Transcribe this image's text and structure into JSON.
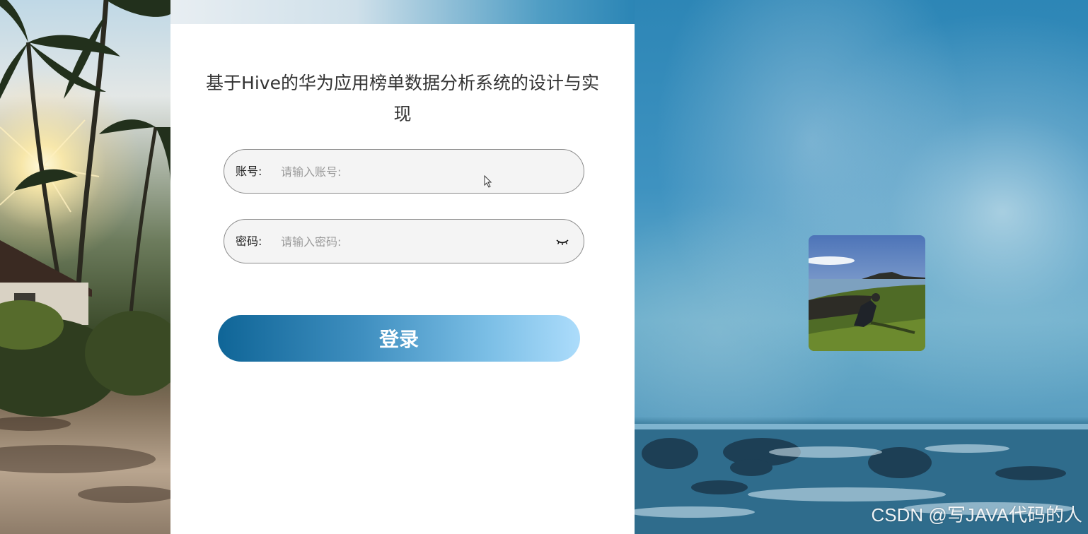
{
  "login": {
    "title": "基于Hive的华为应用榜单数据分析系统的设计与实现",
    "account_label": "账号:",
    "account_placeholder": "请输入账号:",
    "account_value": "",
    "password_label": "密码:",
    "password_placeholder": "请输入密码:",
    "password_value": "",
    "submit_label": "登录"
  },
  "watermark": "CSDN @写JAVA代码的人",
  "icons": {
    "password_toggle": "eye-closed-icon",
    "pointer": "mouse-cursor-icon"
  },
  "colors": {
    "button_gradient_start": "#0f6597",
    "button_gradient_end": "#acdcfb",
    "card_background": "#ffffff",
    "field_background": "#f4f4f4"
  }
}
